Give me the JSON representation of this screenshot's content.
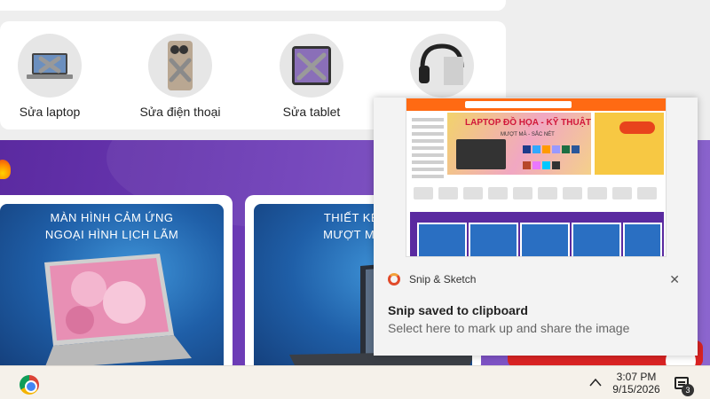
{
  "services": [
    {
      "label": "Sửa laptop",
      "icon": "laptop-repair-icon"
    },
    {
      "label": "Sửa điện thoại",
      "icon": "phone-repair-icon"
    },
    {
      "label": "Sửa tablet",
      "icon": "tablet-repair-icon"
    },
    {
      "label": "",
      "icon": "headphones-icon"
    }
  ],
  "promos": [
    {
      "line1": "MÀN HÌNH CẢM ỨNG",
      "line2": "NGOẠI HÌNH LỊCH LÃM"
    },
    {
      "line1": "THIẾT KẾ MO",
      "line2": "MƯỢT MÀ VÀ"
    }
  ],
  "toast": {
    "app_name": "Snip & Sketch",
    "title": "Snip saved to clipboard",
    "body": "Select here to mark up and share the image",
    "close": "✕",
    "thumb": {
      "hero_title": "LAPTOP ĐỒ HỌA - KỸ THUẬT",
      "hero_sub": "MƯỢT MÀ - SẮC NÉT"
    }
  },
  "taskbar": {
    "time": "3:07 PM",
    "date": "9/15/2026",
    "notification_count": "3",
    "chevron": "^"
  },
  "colors": {
    "banner_purple": "#6e3db8",
    "accent_orange": "#ff6a13",
    "cta_red": "#d92323"
  }
}
